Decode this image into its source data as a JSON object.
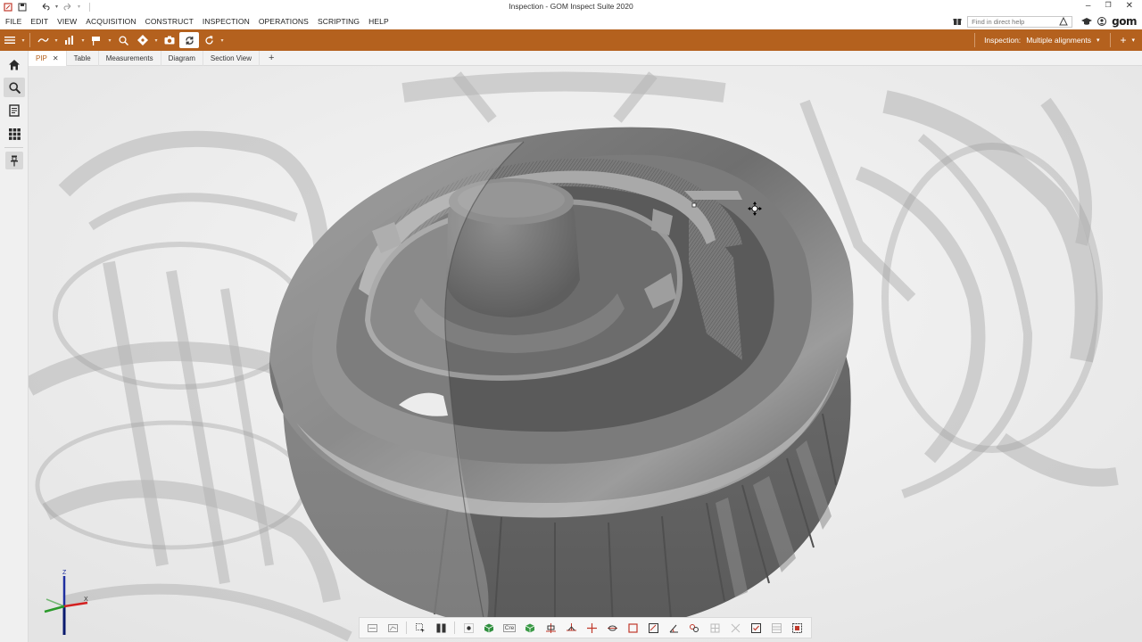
{
  "window": {
    "title": "Inspection - GOM Inspect Suite 2020"
  },
  "menu": [
    "FILE",
    "EDIT",
    "VIEW",
    "ACQUISITION",
    "CONSTRUCT",
    "INSPECTION",
    "OPERATIONS",
    "SCRIPTING",
    "HELP"
  ],
  "help": {
    "placeholder": "Find in direct help"
  },
  "brand": {
    "logo_text": "gom"
  },
  "toolbar": {
    "inspection_label": "Inspection:",
    "inspection_value": "Multiple alignments",
    "accent_color": "#b4611e"
  },
  "tabs": [
    {
      "label": "PIP",
      "active": true
    },
    {
      "label": "Table"
    },
    {
      "label": "Measurements"
    },
    {
      "label": "Diagram"
    },
    {
      "label": "Section View"
    }
  ],
  "tab_add": "+",
  "axes": {
    "z": "Z",
    "x": "X"
  },
  "bottom_toolbar": {
    "text_button": "Cre"
  },
  "icons": {
    "sidebar": [
      "home-icon",
      "search-icon",
      "document-icon",
      "grid-icon",
      "pin-icon"
    ],
    "toolbar": [
      "hamburger-icon",
      "curve-icon",
      "chart-icon",
      "flag-icon",
      "magnifier-icon",
      "target-icon",
      "camera-icon",
      "refresh-icon",
      "reload-icon"
    ]
  }
}
